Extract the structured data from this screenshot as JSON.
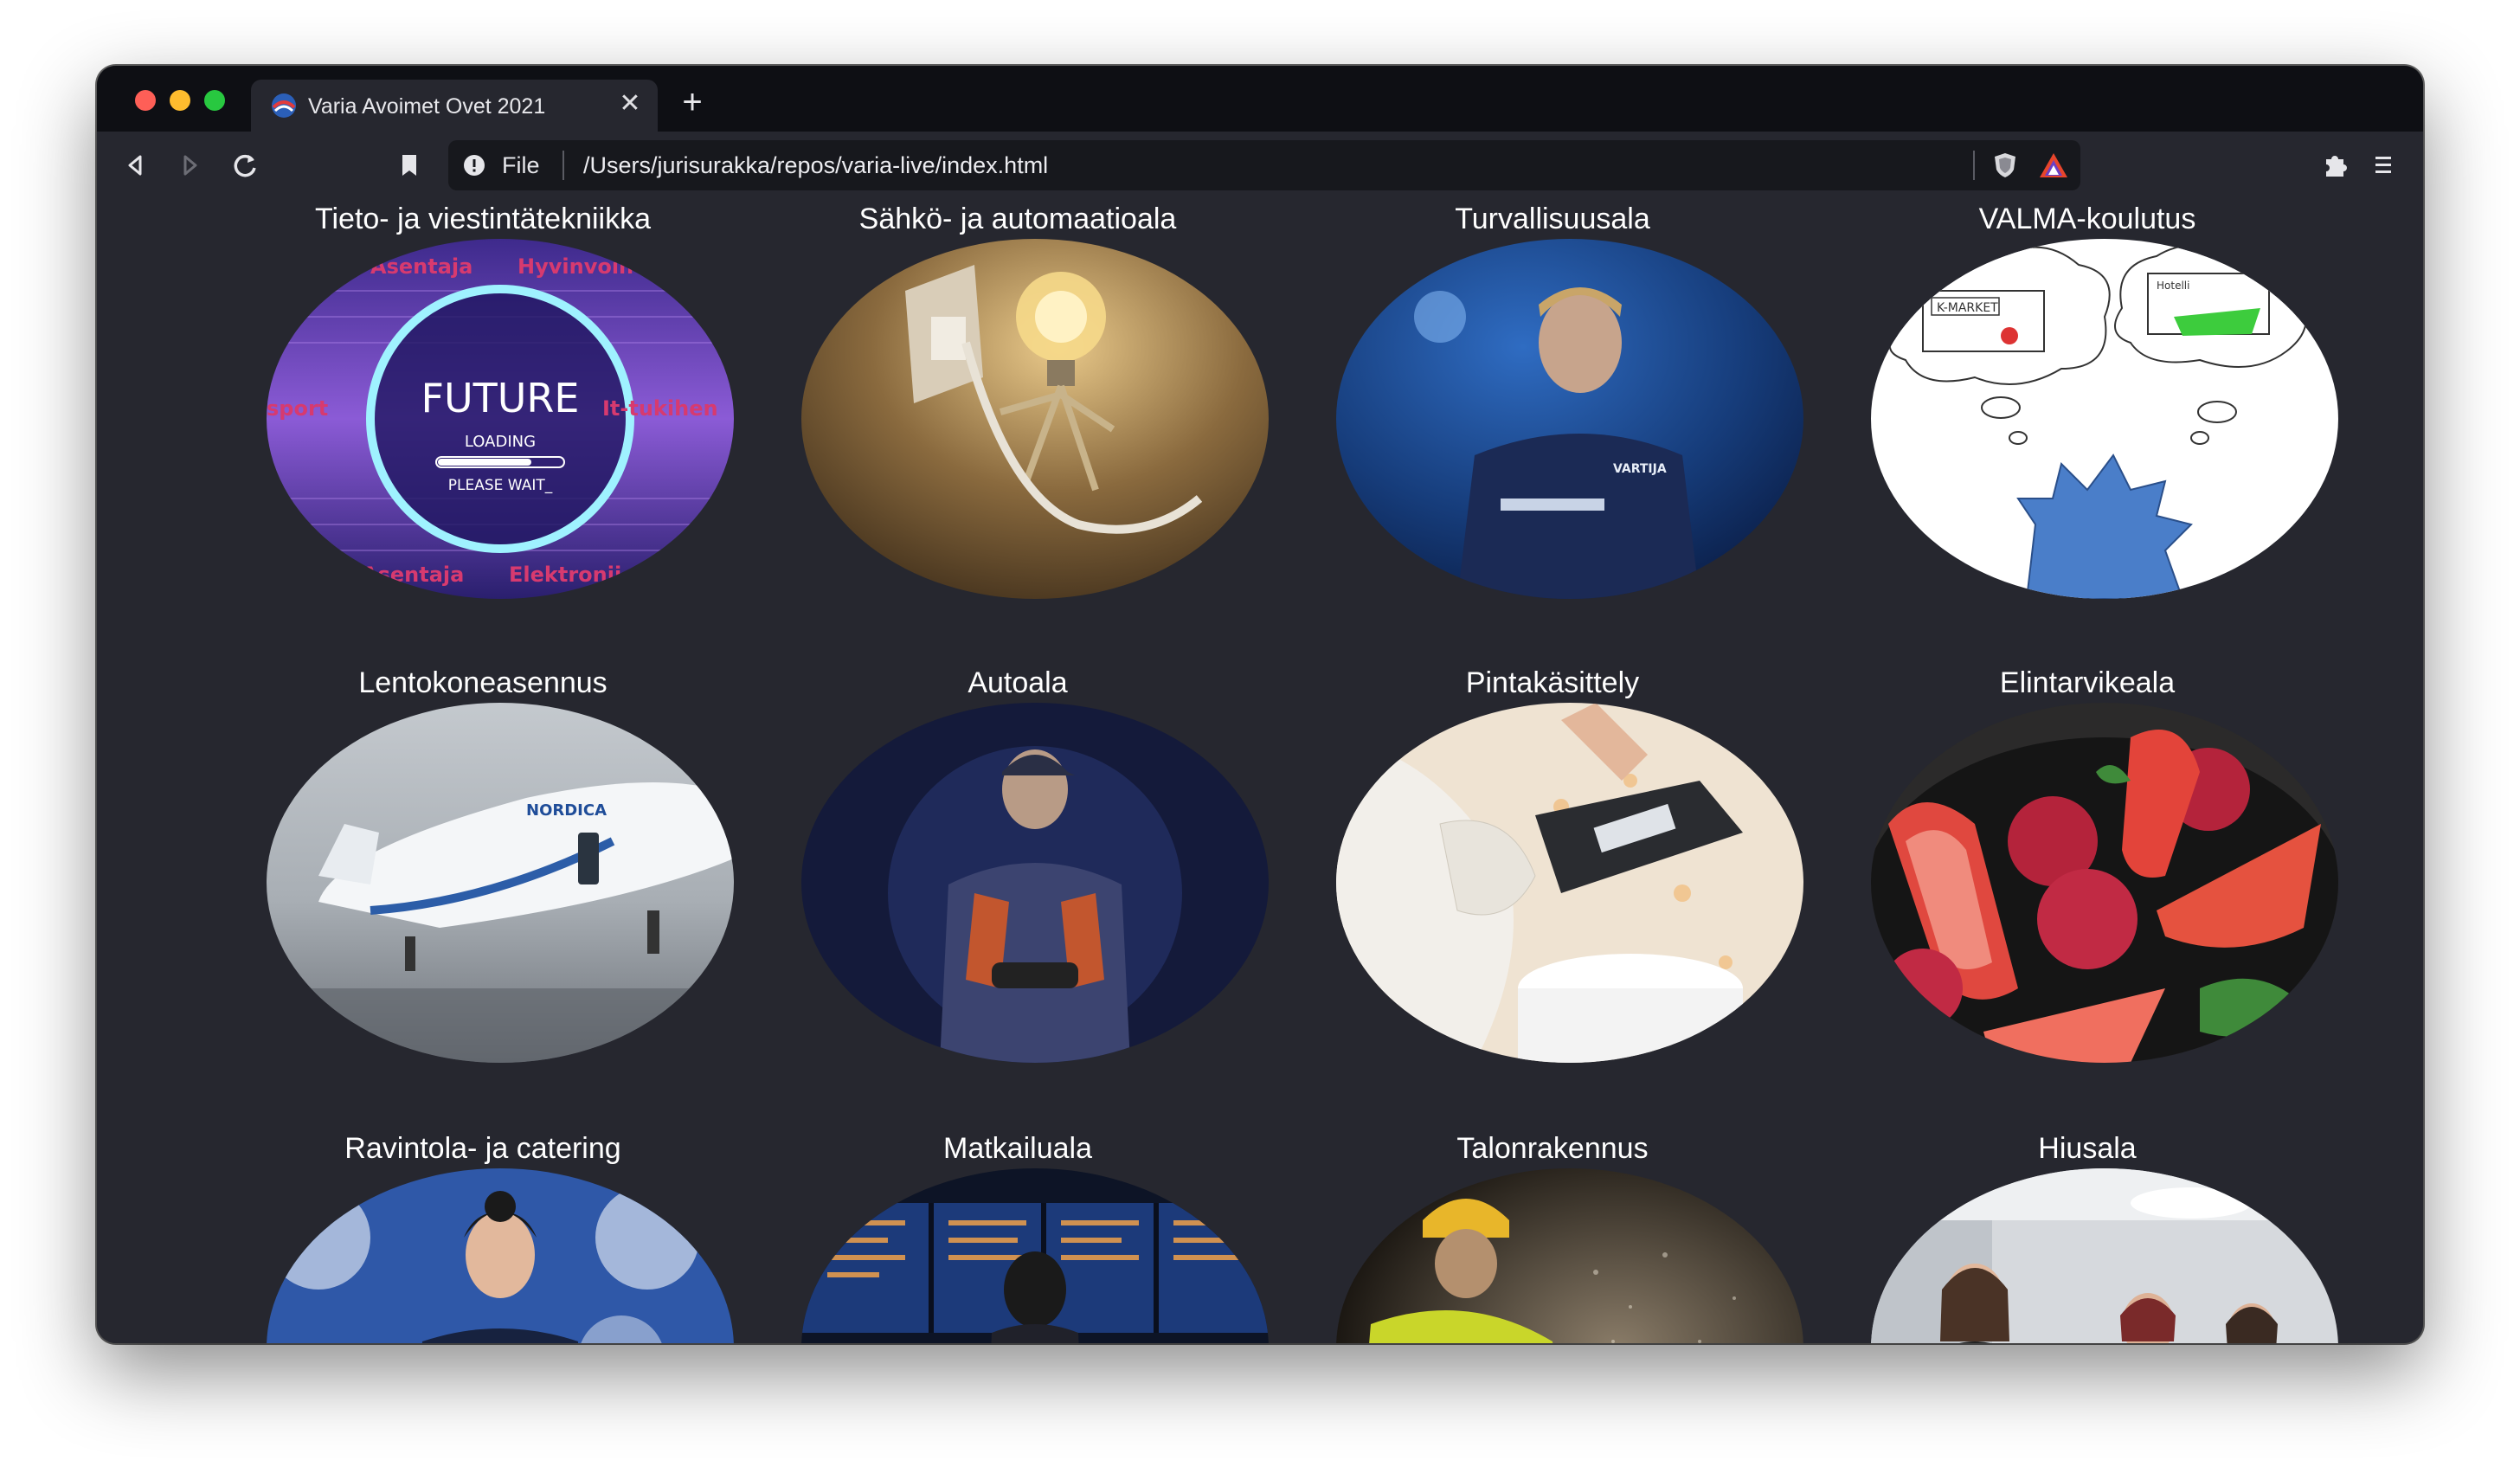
{
  "browser": {
    "tab": {
      "title": "Varia Avoimet Ovet 2021",
      "close_glyph": "✕",
      "favicon": "varia-logo-icon"
    },
    "new_tab_glyph": "+",
    "toolbar": {
      "back": "back-arrow-icon",
      "forward": "forward-arrow-icon",
      "reload": "reload-icon",
      "bookmark": "bookmark-icon",
      "scheme_label": "File",
      "url": "/Users/jurisurakka/repos/varia-live/index.html",
      "shields": "brave-shield-icon",
      "rewards": "brave-rewards-icon",
      "extensions": "puzzle-icon",
      "menu": "hamburger-menu-icon"
    }
  },
  "cards": [
    {
      "title": "Tieto- ja viestintätekniikka",
      "image": "future-loading-graphic",
      "image_text": {
        "main": "FUTURE",
        "loading": "LOADING",
        "wait": "PLEASE WAIT_",
        "words": [
          "Asentaja",
          "Hyvinvoin",
          "sport",
          "It-tukihen",
          "Asentaja",
          "Elektronii"
        ]
      }
    },
    {
      "title": "Sähkö- ja automaatioala",
      "image": "lightbulb-robot-plug"
    },
    {
      "title": "Turvallisuusala",
      "image": "security-guard-portrait",
      "image_text": {
        "badge": "VARTIJA"
      }
    },
    {
      "title": "VALMA-koulutus",
      "image": "thinking-character-sketch",
      "image_text": {
        "shop": "K-MARKET",
        "thought2": "Hotelli"
      }
    },
    {
      "title": "Lentokoneasennus",
      "image": "airplane-on-tarmac",
      "image_text": {
        "livery": "NORDICA"
      }
    },
    {
      "title": "Autoala",
      "image": "mechanic-with-tools"
    },
    {
      "title": "Pintakäsittely",
      "image": "painter-with-spatula"
    },
    {
      "title": "Elintarvikeala",
      "image": "strawberries-raspberries-plate"
    },
    {
      "title": "Ravintola- ja catering",
      "image": "chef-portrait"
    },
    {
      "title": "Matkailuala",
      "image": "airport-departure-board"
    },
    {
      "title": "Talonrakennus",
      "image": "construction-worker-dust"
    },
    {
      "title": "Hiusala",
      "image": "hair-salon-students"
    }
  ],
  "colors": {
    "page_bg": "#26272f",
    "tabstrip_bg": "#0e0f14",
    "omnibox_bg": "#17181d",
    "text": "#ffffff"
  }
}
